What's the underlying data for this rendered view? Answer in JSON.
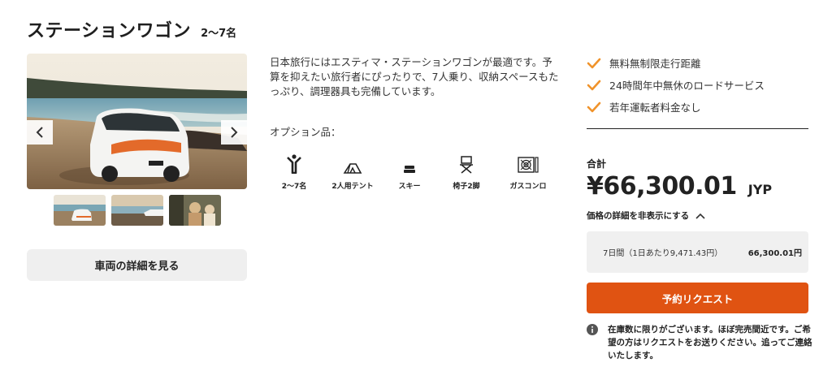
{
  "vehicle": {
    "name": "ステーションワゴン",
    "capacity": "2〜7名",
    "description": "日本旅行にはエスティマ・ステーションワゴンが最適です。予算を抑えたい旅行者にぴったりで、7人乗り、収納スペースもたっぷり、調理器具も完備しています。"
  },
  "gallery": {
    "prev_icon": "chevron-left-icon",
    "next_icon": "chevron-right-icon",
    "thumbnail_count": 3
  },
  "details_button": "車両の詳細を見る",
  "options": {
    "title": "オプション品：",
    "items": [
      {
        "icon": "person-icon",
        "label": "2〜7名"
      },
      {
        "icon": "tent-icon",
        "label": "2人用テント"
      },
      {
        "icon": "ski-icon",
        "label": "スキー"
      },
      {
        "icon": "chair-icon",
        "label": "椅子2脚"
      },
      {
        "icon": "gas-stove-icon",
        "label": "ガスコンロ"
      }
    ]
  },
  "features": [
    "無料無制限走行距離",
    "24時間年中無休のロードサービス",
    "若年運転者料金なし"
  ],
  "pricing": {
    "total_label": "合計",
    "amount": "¥66,300.01",
    "currency": "JYP",
    "toggle_label": "価格の詳細を非表示にする",
    "breakdown_label": "7日間（1日あたり9,471.43円）",
    "breakdown_value": "66,300.01円"
  },
  "request_button": "予約リクエスト",
  "stock_note": "在庫数に限りがございます。ほぼ完売間近です。ご希望の方はリクエストをお送りください。追ってご連絡いたします。",
  "colors": {
    "accent": "#e05312",
    "check": "#f0932b"
  }
}
